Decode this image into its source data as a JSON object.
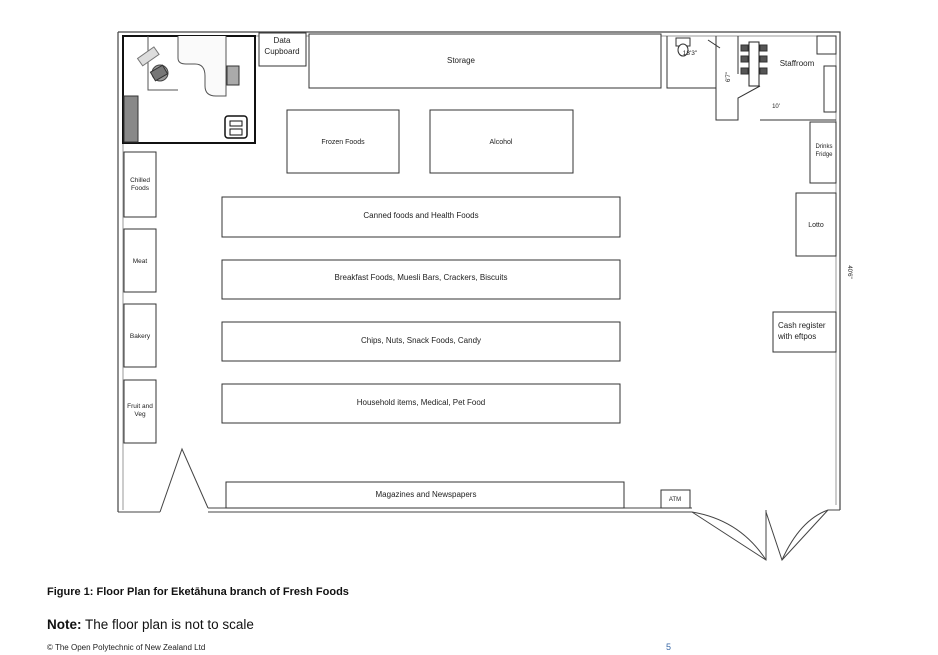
{
  "plan": {
    "storage": "Storage",
    "data_cupboard": [
      "Data",
      "Cupboard"
    ],
    "staffroom": "Staffroom",
    "dim_toilet": "13'3\"",
    "dim_6ft7": "6'7\"",
    "dim_10ft": "10'",
    "dim_wall": "40'6\"",
    "frozen_foods": "Frozen Foods",
    "alcohol": "Alcohol",
    "drinks_fridge": [
      "Drinks",
      "Fridge"
    ],
    "chilled_foods": [
      "Chilled",
      "Foods"
    ],
    "canned_foods": "Canned foods and Health Foods",
    "lotto": "Lotto",
    "meat": "Meat",
    "breakfast": "Breakfast Foods, Muesli Bars, Crackers, Biscuits",
    "cash_register": [
      "Cash register",
      "with eftpos"
    ],
    "bakery": "Bakery",
    "chips": "Chips, Nuts, Snack Foods, Candy",
    "fruit_veg": [
      "Fruit and",
      "Veg"
    ],
    "household": "Household items, Medical, Pet Food",
    "magazines": "Magazines and Newspapers",
    "atm": "ATM"
  },
  "caption": "Figure 1: Floor Plan for Eketāhuna branch of Fresh Foods",
  "note_label": "Note:",
  "note_text": " The floor plan is not to scale",
  "copyright": "© The Open Polytechnic of New Zealand Ltd",
  "page_number": "5"
}
